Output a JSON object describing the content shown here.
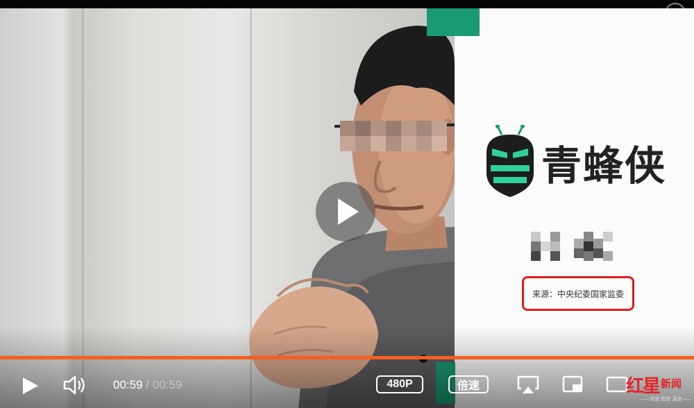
{
  "player": {
    "current_time": "00:59",
    "separator": "/",
    "duration": "00:59",
    "progress_fraction": 1.0,
    "quality_label": "480P",
    "speed_label": "倍速",
    "accent_color": "#f25f1e"
  },
  "slide": {
    "brand_name": "青蜂侠",
    "source_text": "来源：中央纪委国家监委",
    "brand_color": "#1a9a74",
    "highlight_color": "#e21b1b"
  },
  "watermark": {
    "main": "红星",
    "side": "新闻",
    "sub": "——深度·锐度·温度——"
  },
  "icons": {
    "play": "play-icon",
    "volume": "volume-icon",
    "airplay": "airplay-icon",
    "pip": "picture-in-picture-icon",
    "fullscreen": "fullscreen-icon"
  }
}
